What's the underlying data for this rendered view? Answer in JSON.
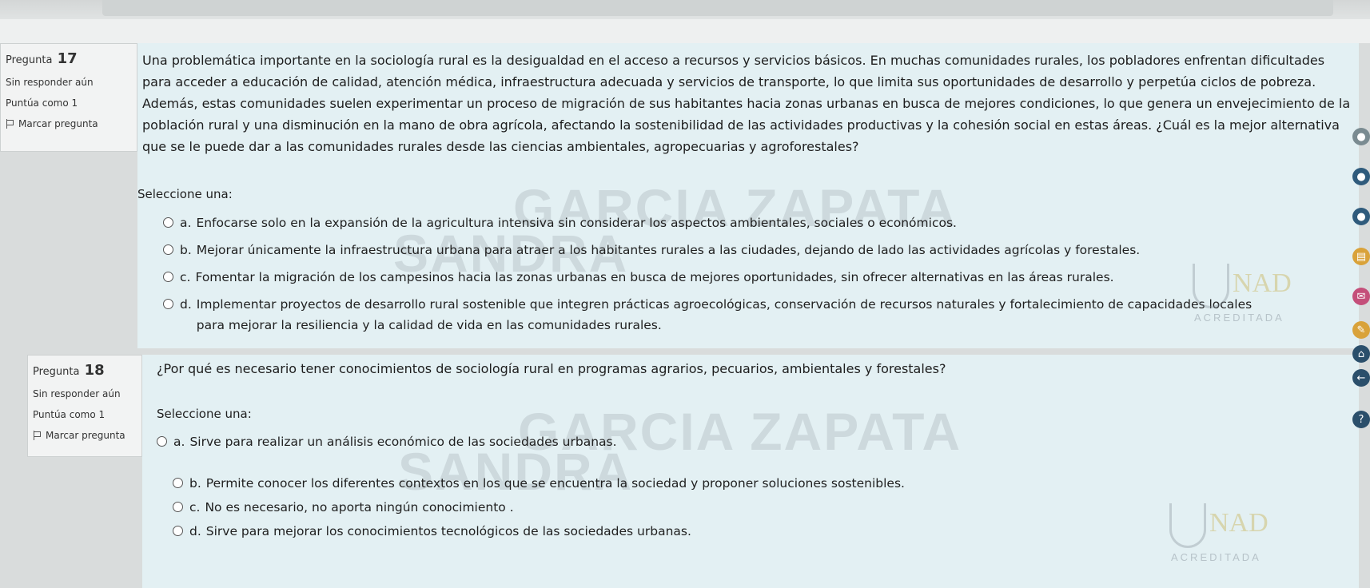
{
  "questions": [
    {
      "label": "Pregunta",
      "number": "17",
      "status": "Sin responder aún",
      "points": "Puntúa como 1",
      "flag_label": "Marcar pregunta",
      "text": "Una problemática importante en la sociología rural es la desigualdad en el acceso a recursos y servicios básicos. En muchas comunidades rurales, los pobladores enfrentan dificultades para acceder a educación de calidad, atención médica, infraestructura adecuada y servicios de transporte, lo que limita sus oportunidades de desarrollo y perpetúa ciclos de pobreza. Además, estas comunidades suelen experimentar un proceso de migración de sus habitantes hacia zonas urbanas en busca de mejores condiciones, lo que genera un envejecimiento de la población rural y una disminución en la mano de obra agrícola, afectando la sostenibilidad de las actividades productivas y la cohesión social en estas áreas. ¿Cuál es la mejor alternativa que se le puede dar a las comunidades rurales desde las ciencias ambientales, agropecuarias y agroforestales?",
      "prompt": "Seleccione una:",
      "options": [
        {
          "letter": "a.",
          "text": "Enfocarse solo en la expansión de la agricultura intensiva sin considerar los aspectos ambientales, sociales o económicos."
        },
        {
          "letter": "b.",
          "text": "Mejorar únicamente la infraestructura urbana para atraer a los habitantes rurales a las ciudades, dejando de lado las actividades agrícolas y forestales."
        },
        {
          "letter": "c.",
          "text": "Fomentar la migración de los campesinos hacia las zonas urbanas en busca de mejores oportunidades, sin ofrecer alternativas en las áreas rurales."
        },
        {
          "letter": "d.",
          "text": "Implementar proyectos de desarrollo rural sostenible que integren prácticas agroecológicas, conservación de recursos naturales y fortalecimiento de capacidades locales para mejorar la resiliencia y la calidad de vida en las comunidades rurales."
        }
      ]
    },
    {
      "label": "Pregunta",
      "number": "18",
      "status": "Sin responder aún",
      "points": "Puntúa como 1",
      "flag_label": "Marcar pregunta",
      "text": "¿Por qué es necesario tener conocimientos de sociología rural en programas agrarios, pecuarios, ambientales y forestales?",
      "prompt": "Seleccione una:",
      "options": [
        {
          "letter": "a.",
          "text": "Sirve para realizar un análisis económico de las sociedades urbanas."
        },
        {
          "letter": "b.",
          "text": "Permite conocer los diferentes contextos en los que se encuentra la sociedad y proponer soluciones sostenibles."
        },
        {
          "letter": "c.",
          "text": "No es necesario, no aporta ningún conocimiento ."
        },
        {
          "letter": "d.",
          "text": "Sirve para mejorar los conocimientos tecnológicos de las sociedades urbanas."
        }
      ]
    }
  ],
  "watermarks": {
    "line1": "GARCIA ZAPATA",
    "line2": "SANDRA",
    "logo_letters": "NAD",
    "logo_text": "ACREDITADA"
  },
  "side_tools": [
    {
      "icon": "circle-icon",
      "color": "#7a8b91"
    },
    {
      "icon": "circle-icon",
      "color": "#2f5b7c"
    },
    {
      "icon": "circle-icon",
      "color": "#2f5b7c"
    },
    {
      "icon": "document-icon",
      "color": "#d9a23a"
    },
    {
      "icon": "mail-icon",
      "color": "#c44f7a"
    },
    {
      "icon": "edit-icon",
      "color": "#d9a23a"
    },
    {
      "icon": "home-icon",
      "color": "#2b4f6b"
    },
    {
      "icon": "back-arrow-icon",
      "color": "#2b4f6b"
    },
    {
      "icon": "help-icon",
      "color": "#2b4f6b"
    }
  ]
}
